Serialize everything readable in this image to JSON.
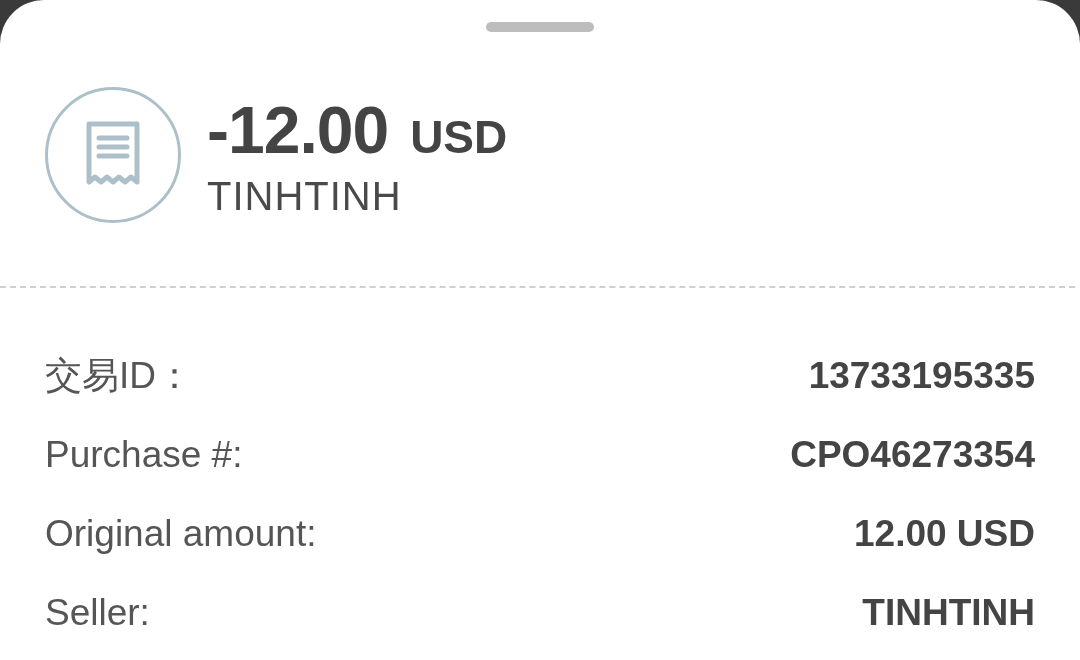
{
  "amount": {
    "value": "-12.00",
    "currency": "USD"
  },
  "merchant": "TINHTINH",
  "details": [
    {
      "label": "交易ID：",
      "value": "13733195335"
    },
    {
      "label": "Purchase #:",
      "value": "CPO46273354"
    },
    {
      "label": "Original amount:",
      "value": "12.00 USD"
    },
    {
      "label": "Seller:",
      "value": "TINHTINH"
    }
  ]
}
